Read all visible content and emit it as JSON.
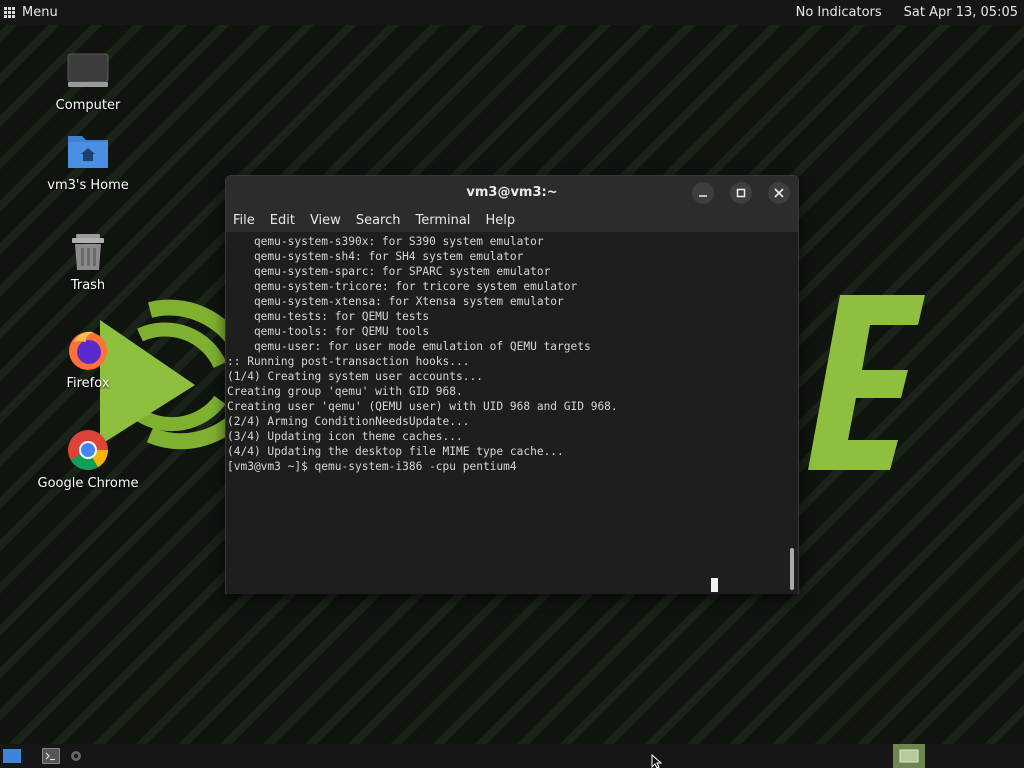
{
  "top_panel": {
    "menu_label": "Menu",
    "indicators": "No Indicators",
    "clock": "Sat Apr 13, 05:05"
  },
  "desktop_icons": [
    {
      "label": "Computer",
      "icon": "computer-icon"
    },
    {
      "label": "vm3's Home",
      "icon": "home-folder-icon"
    },
    {
      "label": "Trash",
      "icon": "trash-icon"
    },
    {
      "label": "Firefox",
      "icon": "firefox-icon"
    },
    {
      "label": "Google Chrome",
      "icon": "chrome-icon"
    }
  ],
  "terminal": {
    "title": "vm3@vm3:~",
    "menu": [
      "File",
      "Edit",
      "View",
      "Search",
      "Terminal",
      "Help"
    ],
    "lines": [
      "    qemu-system-s390x: for S390 system emulator",
      "    qemu-system-sh4: for SH4 system emulator",
      "    qemu-system-sparc: for SPARC system emulator",
      "    qemu-system-tricore: for tricore system emulator",
      "    qemu-system-xtensa: for Xtensa system emulator",
      "    qemu-tests: for QEMU tests",
      "    qemu-tools: for QEMU tools",
      "    qemu-user: for user mode emulation of QEMU targets",
      ":: Running post-transaction hooks...",
      "(1/4) Creating system user accounts...",
      "Creating group 'qemu' with GID 968.",
      "Creating user 'qemu' (QEMU user) with UID 968 and GID 968.",
      "(2/4) Arming ConditionNeedsUpdate...",
      "(3/4) Updating icon theme caches...",
      "(4/4) Updating the desktop file MIME type cache...",
      "[vm3@vm3 ~]$ qemu-system-i386 -cpu pentium4"
    ]
  },
  "taskbar": {
    "items": [
      "show-desktop-icon",
      "terminal-icon",
      "settings-icon",
      "workspace-switcher-icon"
    ]
  },
  "colors": {
    "accent_green": "#8fbf3f",
    "panel_bg": "#161616",
    "terminal_bg": "#1e1e1e"
  }
}
